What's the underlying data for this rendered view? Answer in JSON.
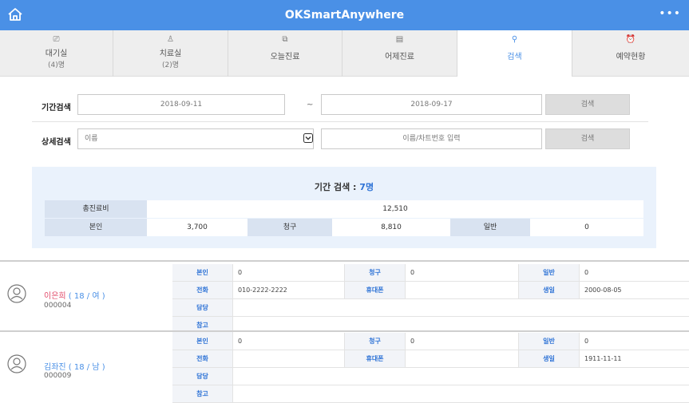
{
  "app": {
    "title": "OKSmartAnywhere"
  },
  "tabs": [
    {
      "label": "대기실",
      "count": "(4)명",
      "icon": "door-icon"
    },
    {
      "label": "치료실",
      "count": "(2)명",
      "icon": "person-icon"
    },
    {
      "label": "오늘진료",
      "icon": "copy-icon"
    },
    {
      "label": "어제진료",
      "icon": "calendar-icon"
    },
    {
      "label": "검색",
      "icon": "search-icon"
    },
    {
      "label": "예약현황",
      "icon": "alarm-icon"
    }
  ],
  "search": {
    "period_label": "기간검색",
    "date_from": "2018-09-11",
    "tilde": "~",
    "date_to": "2018-09-17",
    "search_button": "검색",
    "detail_label": "상세검색",
    "detail_select": "이름",
    "detail_placeholder": "이름/차트번호 입력",
    "detail_button": "검색"
  },
  "summary": {
    "title_prefix": "기간 검색 : ",
    "count": "7명",
    "total_label": "총진료비",
    "total_value": "12,510",
    "self_label": "본인",
    "self_value": "3,700",
    "claim_label": "청구",
    "claim_value": "8,810",
    "general_label": "일반",
    "general_value": "0"
  },
  "patients": [
    {
      "name": "이은희",
      "meta": "( 18 / 여 )",
      "id": "000004",
      "self_label": "본인",
      "self": "0",
      "claim_label": "청구",
      "claim": "0",
      "general_label": "일반",
      "general": "0",
      "phone_label": "전화",
      "phone": "010-2222-2222",
      "mobile_label": "휴대폰",
      "mobile": "",
      "birth_label": "생일",
      "birth": "2000-08-05",
      "manager_label": "담당",
      "manager": "",
      "note_label": "참고",
      "note": ""
    },
    {
      "name": "김좌진",
      "meta": "( 18 / 남 )",
      "id": "000009",
      "self_label": "본인",
      "self": "0",
      "claim_label": "청구",
      "claim": "0",
      "general_label": "일반",
      "general": "0",
      "phone_label": "전화",
      "phone": "",
      "mobile_label": "휴대폰",
      "mobile": "",
      "birth_label": "생일",
      "birth": "1911-11-11",
      "manager_label": "담당",
      "manager": "",
      "note_label": "참고",
      "note": ""
    }
  ],
  "colors": {
    "brand": "#4a90e6",
    "female": "#e24c6b",
    "summary_bg": "#eaf2fc"
  }
}
